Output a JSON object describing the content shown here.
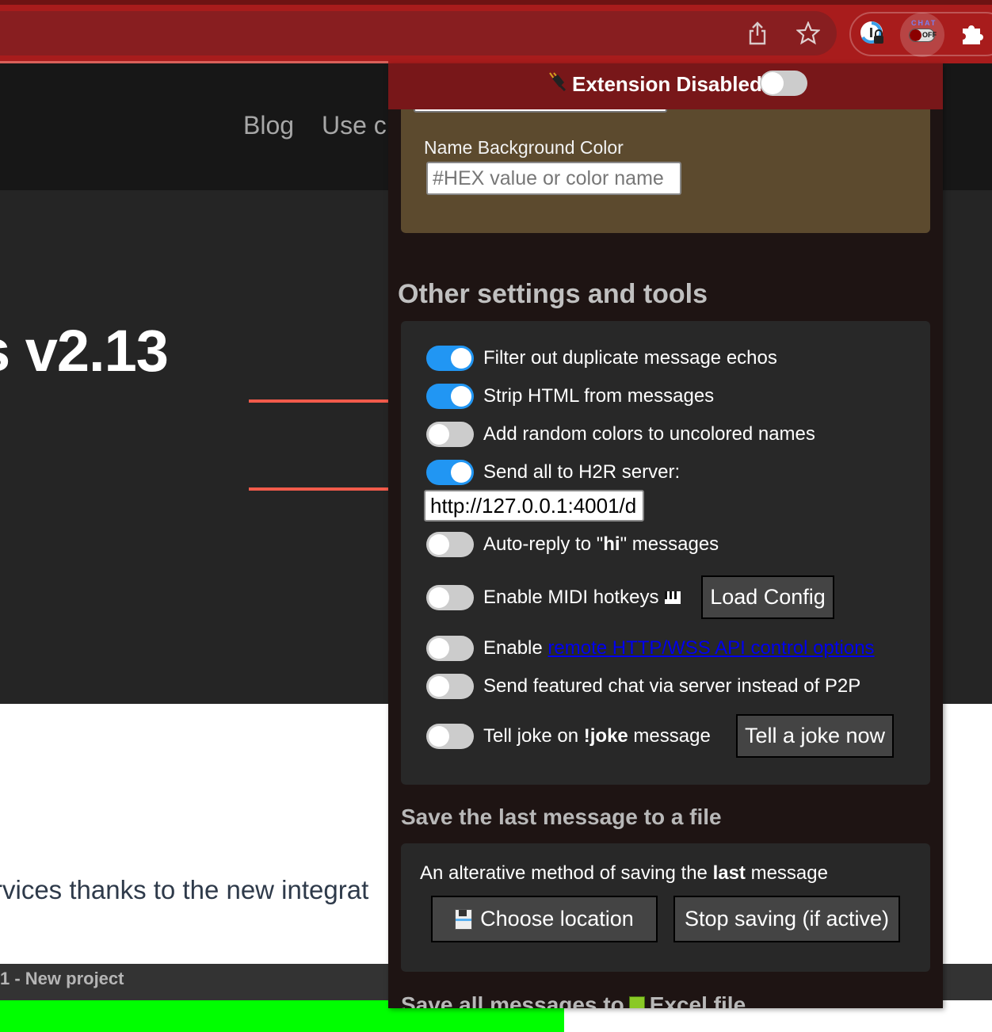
{
  "browser": {
    "toolbar_icons": [
      "share-icon",
      "bookmark-star-icon",
      "password-manager-icon",
      "chat-extension-icon",
      "extensions-puzzle-icon"
    ],
    "chat_extension": {
      "label": "CHAT",
      "state": "OFF",
      "accent": "#8b0000"
    }
  },
  "webpage": {
    "nav": [
      "Blog",
      "Use c"
    ],
    "hero_title": "s v2.13",
    "body_text": "rvices thanks to the new integrat",
    "project_bar": "1 - New project"
  },
  "popup": {
    "header": {
      "icon": "plug-icon",
      "title": "Extension Disabled",
      "enabled": false
    },
    "name_card": {
      "bg_label": "Name Background Color",
      "bg_placeholder": "#HEX value or color name",
      "card_color": "#5c4a2e"
    },
    "other_settings": {
      "title": "Other settings and tools",
      "toggles": [
        {
          "label": "Filter out duplicate message echos",
          "on": true
        },
        {
          "label": "Strip HTML from messages",
          "on": true
        },
        {
          "label": "Add random colors to uncolored names",
          "on": false
        },
        {
          "label": "Send all to H2R server:",
          "on": true
        },
        {
          "label_pre": "Auto-reply to \"",
          "label_bold": "hi",
          "label_post": "\" messages",
          "on": false
        },
        {
          "label": "Enable MIDI hotkeys",
          "icon": "piano-keys-icon",
          "on": false
        },
        {
          "label_pre": "Enable ",
          "link": "remote HTTP/WSS API control options",
          "on": false
        },
        {
          "label": "Send featured chat via server instead of P2P",
          "on": false
        },
        {
          "label_pre": "Tell joke on ",
          "label_bold": "!joke",
          "label_post": " message",
          "on": false
        }
      ],
      "h2r_url": "http://127.0.0.1:4001/d",
      "load_config_button": "Load Config",
      "tell_joke_button": "Tell a joke now",
      "toggle_on_color": "#2196f3"
    },
    "save_last": {
      "title": "Save the last message to a file",
      "desc_pre": "An alterative method of saving the ",
      "desc_bold": "last",
      "desc_post": " message",
      "choose_location_button": "Choose location",
      "stop_saving_button": "Stop saving (if active)"
    },
    "save_all": {
      "title_pre": "Save all messages to",
      "title_post": "Excel file"
    }
  },
  "annotations": {
    "arrow_color": "#f25b4b",
    "arrow_count": 2
  }
}
